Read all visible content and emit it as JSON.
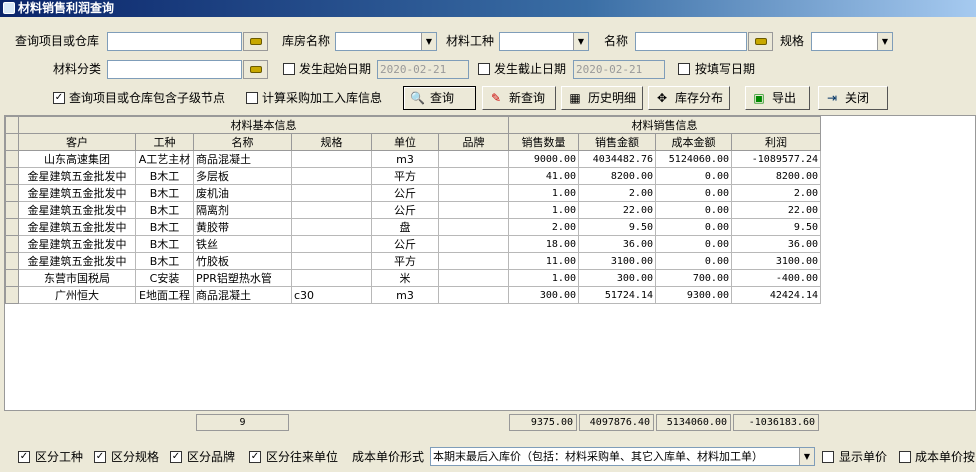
{
  "window": {
    "title": "材料销售利润查询"
  },
  "filters": {
    "project_label": "查询项目或仓库",
    "warehouse_label": "库房名称",
    "trade_label": "材料工种",
    "name_label": "名称",
    "spec_label": "规格",
    "category_label": "材料分类",
    "start_date_label": "发生起始日期",
    "start_date": "2020-02-21",
    "end_date_label": "发生截止日期",
    "end_date": "2020-02-21",
    "by_fill_date_label": "按填写日期",
    "include_children_label": "查询项目或仓库包含子级节点",
    "calc_purchase_label": "计算采购加工入库信息"
  },
  "toolbar": {
    "query": "查询",
    "new_query": "新查询",
    "history": "历史明细",
    "stock": "库存分布",
    "export": "导出",
    "close": "关闭"
  },
  "table": {
    "group_basic": "材料基本信息",
    "group_sales": "材料销售信息",
    "columns": [
      "客户",
      "工种",
      "名称",
      "规格",
      "单位",
      "品牌",
      "销售数量",
      "销售金额",
      "成本金额",
      "利润"
    ],
    "rows": [
      [
        "山东高速集团",
        "A工艺主材",
        "商品混凝土",
        "",
        "m3",
        "",
        "9000.00",
        "4034482.76",
        "5124060.00",
        "-1089577.24"
      ],
      [
        "金星建筑五金批发中",
        "B木工",
        "多层板",
        "",
        "平方",
        "",
        "41.00",
        "8200.00",
        "0.00",
        "8200.00"
      ],
      [
        "金星建筑五金批发中",
        "B木工",
        "废机油",
        "",
        "公斤",
        "",
        "1.00",
        "2.00",
        "0.00",
        "2.00"
      ],
      [
        "金星建筑五金批发中",
        "B木工",
        "隔离剂",
        "",
        "公斤",
        "",
        "1.00",
        "22.00",
        "0.00",
        "22.00"
      ],
      [
        "金星建筑五金批发中",
        "B木工",
        "黄胶带",
        "",
        "盘",
        "",
        "2.00",
        "9.50",
        "0.00",
        "9.50"
      ],
      [
        "金星建筑五金批发中",
        "B木工",
        "铁丝",
        "",
        "公斤",
        "",
        "18.00",
        "36.00",
        "0.00",
        "36.00"
      ],
      [
        "金星建筑五金批发中",
        "B木工",
        "竹胶板",
        "",
        "平方",
        "",
        "11.00",
        "3100.00",
        "0.00",
        "3100.00"
      ],
      [
        "东营市国税局",
        "C安装",
        "PPR铝塑热水管",
        "",
        "米",
        "",
        "1.00",
        "300.00",
        "700.00",
        "-400.00"
      ],
      [
        "广州恒大",
        "E地面工程",
        "商品混凝土",
        "c30",
        "m3",
        "",
        "300.00",
        "51724.14",
        "9300.00",
        "42424.14"
      ]
    ],
    "footer": {
      "count": "9",
      "qty": "9375.00",
      "sales": "4097876.40",
      "cost": "5134060.00",
      "profit": "-1036183.60"
    }
  },
  "bottom": {
    "by_trade": "区分工种",
    "by_spec": "区分规格",
    "by_brand": "区分品牌",
    "by_partner": "区分往来单位",
    "cost_mode_label": "成本单价形式",
    "cost_mode_value": "本期末最后入库价（包括：材料采购单、其它入库单、材料加工单）",
    "show_price": "显示单价",
    "cost_by": "成本单价按"
  }
}
